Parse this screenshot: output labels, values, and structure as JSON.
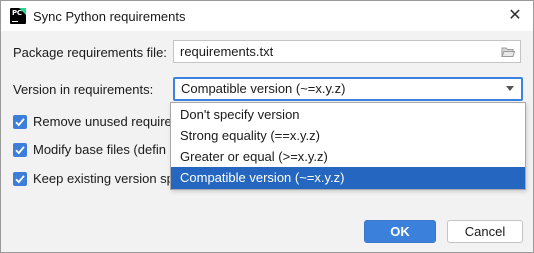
{
  "window": {
    "title": "Sync Python requirements",
    "close_glyph": "✕",
    "app_icon": "pycharm-icon",
    "app_icon_text": "PC"
  },
  "form": {
    "package_file_label": "Package requirements file:",
    "package_file_value": "requirements.txt",
    "version_label": "Version in requirements:",
    "version_value": "Compatible version (~=x.y.z)"
  },
  "checkboxes": [
    {
      "label": "Remove unused require",
      "checked": true
    },
    {
      "label": "Modify base files (defin",
      "checked": true
    },
    {
      "label": "Keep existing version sp",
      "checked": true
    }
  ],
  "dropdown": {
    "options": [
      "Don't specify version",
      "Strong equality (==x.y.z)",
      "Greater or equal (>=x.y.z)",
      "Compatible version (~=x.y.z)"
    ],
    "selected_index": 3
  },
  "buttons": {
    "ok": "OK",
    "cancel": "Cancel"
  },
  "colors": {
    "accent": "#3b80db",
    "selection": "#2567c0",
    "checkbox": "#3c7ed8"
  }
}
